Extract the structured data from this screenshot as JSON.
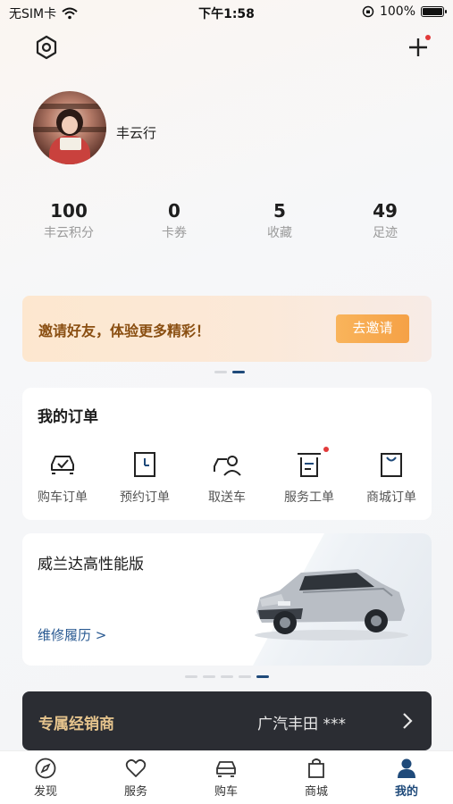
{
  "status_bar": {
    "carrier": "无SIM卡",
    "time": "下午1:58",
    "battery": "100%"
  },
  "profile": {
    "username": "丰云行"
  },
  "stats": [
    {
      "value": "100",
      "label": "丰云积分"
    },
    {
      "value": "0",
      "label": "卡券"
    },
    {
      "value": "5",
      "label": "收藏"
    },
    {
      "value": "49",
      "label": "足迹"
    }
  ],
  "invite": {
    "text": "邀请好友，体验更多精彩！",
    "button": "去邀请"
  },
  "orders": {
    "title": "我的订单",
    "items": [
      {
        "label": "购车订单",
        "icon": "car-order-icon"
      },
      {
        "label": "预约订单",
        "icon": "appointment-order-icon"
      },
      {
        "label": "取送车",
        "icon": "pickup-delivery-icon"
      },
      {
        "label": "服务工单",
        "icon": "service-order-icon"
      },
      {
        "label": "商城订单",
        "icon": "mall-order-icon"
      }
    ]
  },
  "car": {
    "model": "威兰达高性能版",
    "link": "维修履历 >"
  },
  "dealer": {
    "label": "专属经销商",
    "value": "广汽丰田 ***"
  },
  "tabbar": [
    {
      "label": "发现",
      "icon": "compass-icon"
    },
    {
      "label": "服务",
      "icon": "heart-icon"
    },
    {
      "label": "购车",
      "icon": "car-icon"
    },
    {
      "label": "商城",
      "icon": "shopping-bag-icon"
    },
    {
      "label": "我的",
      "icon": "person-icon",
      "active": true
    }
  ],
  "colors": {
    "accent": "#1f4a7a",
    "invite_button": "#f5a146",
    "dealer_label": "#e6c48d",
    "badge": "#e23a3a"
  }
}
